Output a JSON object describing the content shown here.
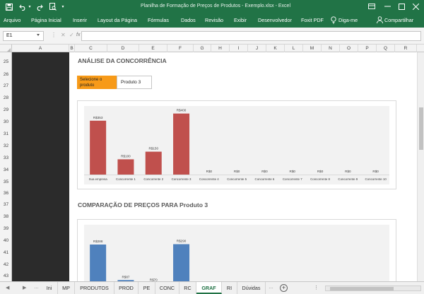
{
  "window": {
    "title": "Planilha de Formação de Preços de Produtos - Exemplo.xlsx - Excel"
  },
  "ribbon": {
    "tabs": [
      "Arquivo",
      "Página Inicial",
      "Inserir",
      "Layout da Página",
      "Fórmulas",
      "Dados",
      "Revisão",
      "Exibir",
      "Desenvolvedor",
      "Foxit PDF"
    ],
    "tell_me": "Diga-me",
    "share": "Compartilhar"
  },
  "formula_bar": {
    "name_box": "E1",
    "formula": "",
    "fx": "fx"
  },
  "grid": {
    "columns": [
      "A",
      "B",
      "C",
      "D",
      "E",
      "F",
      "G",
      "H",
      "I",
      "J",
      "K",
      "L",
      "M",
      "N",
      "O",
      "P",
      "Q",
      "R"
    ],
    "rows": [
      "25",
      "26",
      "27",
      "28",
      "29",
      "30",
      "31",
      "32",
      "33",
      "34",
      "35",
      "36",
      "37",
      "38",
      "39",
      "40",
      "41",
      "42",
      "43"
    ]
  },
  "section1": {
    "title": "ANÁLISE DA CONCORRÊNCIA",
    "select_label": "Selecione o produto",
    "select_value": "Produto 3"
  },
  "section2": {
    "title": "COMPARAÇÃO DE PREÇOS PARA Produto 3"
  },
  "chart_data": [
    {
      "type": "bar",
      "color": "#c0504d",
      "categories": [
        "Sua empresa",
        "Concorrente 1",
        "Concorrente 2",
        "Concorrente 3",
        "Concorrente 4",
        "Concorrente 5",
        "Concorrente 6",
        "Concorrente 7",
        "Concorrente 8",
        "Concorrente 9",
        "Concorrente 10"
      ],
      "values": [
        353,
        100,
        150,
        400,
        0,
        0,
        0,
        0,
        0,
        0,
        0
      ],
      "labels": [
        "R$353",
        "R$100",
        "R$150",
        "R$400",
        "R$0",
        "R$0",
        "R$0",
        "R$0",
        "R$0",
        "R$0",
        "R$0"
      ],
      "ylim": [
        0,
        440
      ]
    },
    {
      "type": "bar",
      "color": "#4f81bd",
      "values": [
        288,
        87,
        70,
        290
      ],
      "labels": [
        "R$288",
        "R$87",
        "R$70",
        "R$290"
      ],
      "ylim": [
        0,
        360
      ]
    }
  ],
  "sheet_tabs": {
    "items": [
      "Ini",
      "MP",
      "PRODUTOS",
      "PROD",
      "PE",
      "CONC",
      "RC",
      "GRAF",
      "RI",
      "Dúvidas"
    ],
    "active": "GRAF"
  },
  "icons": [
    "save-icon",
    "undo-icon",
    "redo-icon",
    "print-preview-icon",
    "customize-icon",
    "ribbon-display-icon",
    "minimize-icon",
    "maximize-icon",
    "close-icon",
    "lightbulb-icon",
    "user-icon",
    "cancel-icon",
    "enter-icon",
    "function-icon",
    "add-sheet-icon"
  ]
}
